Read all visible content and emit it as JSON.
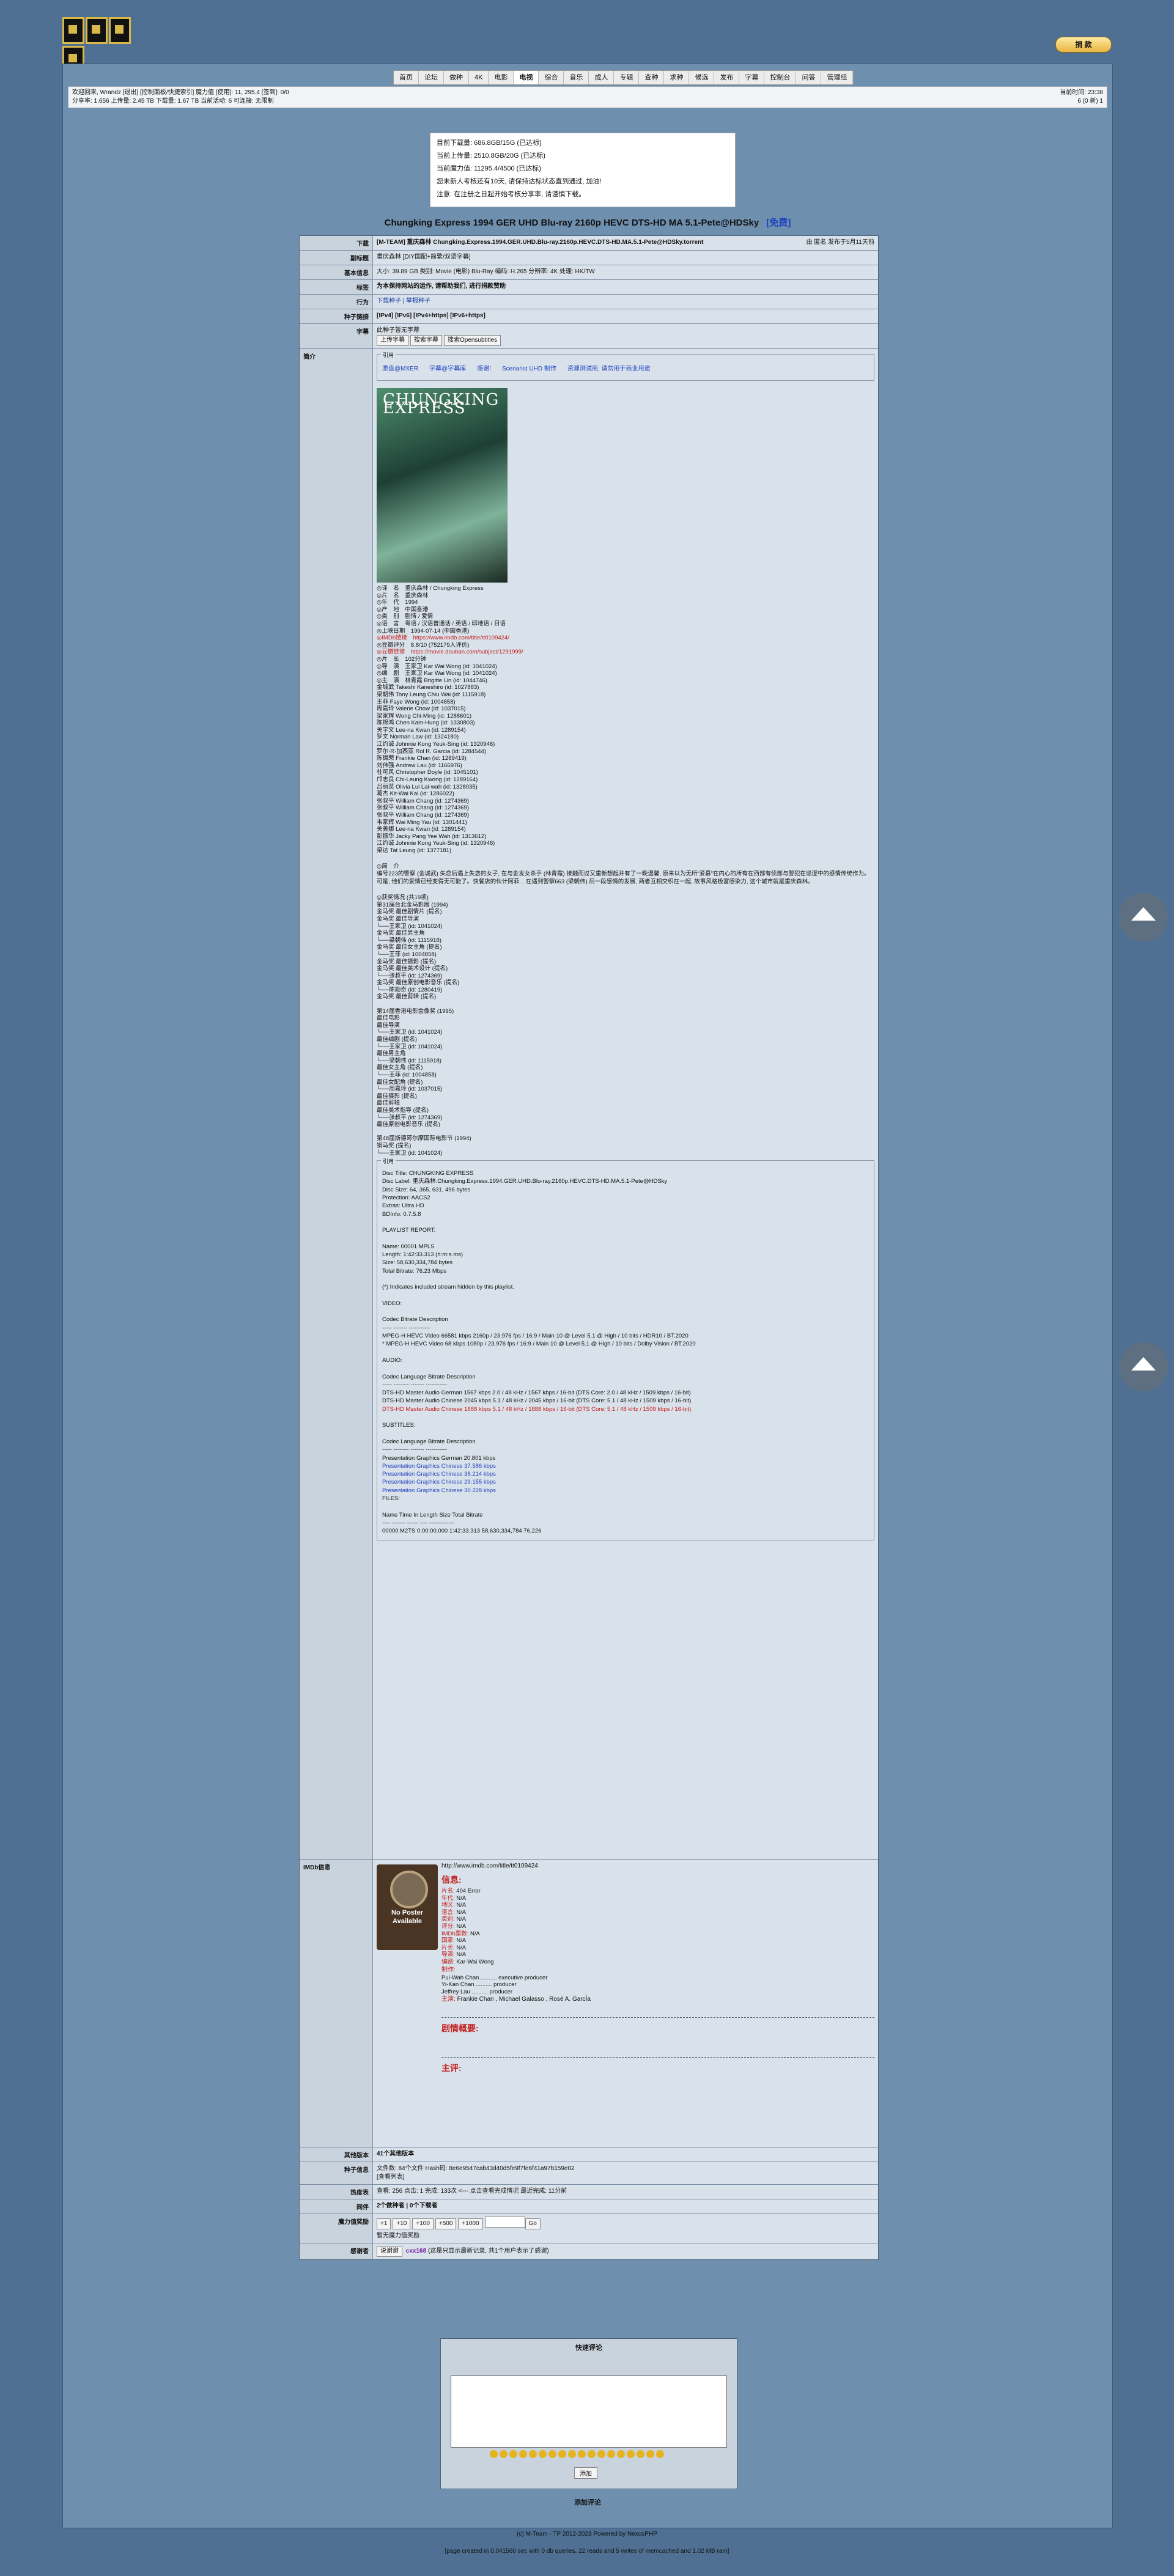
{
  "site": {
    "top_button": "捐 款"
  },
  "nav": [
    "首页",
    "论坛",
    "做种",
    "4K",
    "电影",
    "电视",
    "综合",
    "音乐",
    "成人",
    "专辑",
    "查种",
    "求种",
    "候选",
    "发布",
    "字幕",
    "控制台",
    "问答",
    "管理组"
  ],
  "nav_active": "电视",
  "userbar": {
    "left1": "欢迎回来, Wrandz [退出] [控制面板/快捷索引] 魔力值 [使用]: 11, 295.4 [签到]: 0/0",
    "left2": "分享率: 1.656 上传量: 2.45 TB 下载量: 1.67 TB 当前活动: 6 可连接: 无限制",
    "right1": "当前时间: 23:38",
    "right2": "6 (0 新) 1"
  },
  "notice": [
    "目前下载量: 686.8GB/15G (已达标)",
    "当前上传量: 2510.8GB/20G (已达标)",
    "当前魔力值: 11295.4/4500 (已达标)",
    "您未新人考核还有10天, 请保持达标状态直到通过, 加油!",
    "注意: 在注册之日起开始考核分享率, 请谨慎下载。"
  ],
  "title": "Chungking Express 1994 GER UHD Blu-ray 2160p HEVC DTS-HD MA 5.1-Pete@HDSky",
  "title_tag": "[免费]",
  "rows": {
    "download": {
      "label": "下载",
      "value": "[M-TEAM] 重庆森林 Chungking.Express.1994.GER.UHD.Blu-ray.2160p.HEVC.DTS-HD.MA.5.1-Pete@HDSky.torrent",
      "extra": "由 匿名 发布于5月11天前"
    },
    "subtitle": {
      "label": "副标题",
      "value": "重庆森林 [DIY国配+简繁/双语字幕]"
    },
    "basic": {
      "label": "基本信息",
      "value": "大小: 39.89 GB  类别: Movie (电影)  Blu-Ray 编码: H.265  分辨率: 4K  处理: HK/TW"
    },
    "tag": {
      "label": "标签",
      "value": "为本保持网站的运作, 请帮助我们, 进行捐款赞助"
    },
    "action": {
      "label": "行为",
      "value": "下载种子 | 举报种子"
    },
    "link": {
      "label": "种子链接",
      "value": "[IPv4] [IPv6] [IPv4+https] [IPv6+https]"
    },
    "subs": {
      "label": "字幕",
      "value": "此种子暂无字幕",
      "btns": [
        "上传字幕",
        "搜索字幕",
        "搜索Opensubtitles"
      ]
    },
    "intro": {
      "label": "简介"
    }
  },
  "quote_top": {
    "title": "引用",
    "items": [
      "原盘@MXER",
      "字幕@字幕库",
      "感谢!",
      "Scenarist UHD 制作",
      "资源测试用, 请勿用于商业用途"
    ]
  },
  "poster_text": "CHUNGKING EXPRESS",
  "info_lines": [
    "◎译　名　重庆森林 / Chungking Express",
    "◎片　名　重庆森林",
    "◎年　代　1994",
    "◎产　地　中国香港",
    "◎类　别　剧情 / 爱情",
    "◎语　言　粤语 / 汉语普通话 / 英语 / 印地语 / 日语",
    "◎上映日期　1994-07-14 (中国香港)",
    "◎IMDb链接　https://www.imdb.com/title/tt0109424/",
    "◎豆瓣评分　8.8/10 (752179人评价)",
    "◎豆瓣链接　https://movie.douban.com/subject/1291999/",
    "◎片　长　102分钟",
    "◎导　演　王家卫 Kar Wai Wong (id: 1041024)",
    "◎编　剧　王家卫 Kar Wai Wong (id: 1041024)",
    "◎主　演　林青霞 Brigitte Lin (id: 1044746)",
    "金城武 Takeshi Kaneshiro (id: 1027883)",
    "梁朝伟 Tony Leung Chiu Wai (id: 1115918)",
    "王菲 Faye Wong (id: 1004858)",
    "周嘉玲 Valerie Chow (id: 1037015)",
    "梁家辉 Wong Chi-Ming (id: 1288601)",
    "陈锦鸿 Chen Kam-Hung (id: 1330803)",
    "关学文 Lee-na Kwan (id: 1289154)",
    "罗文 Norman Law (id: 1324180)",
    "江约诚 Johnnie Kong Yeuk-Sing (id: 1320946)",
    "罗尔·R·加西亚 Rol R. Garcia (id: 1284544)",
    "陈锦荣 Frankie Chan (id: 1289419)",
    "刘伟强 Andrew Lau (id: 1166976)",
    "杜可风 Christopher Doyle (id: 1045101)",
    "邝志良 Chi-Leung Kwong (id: 1289164)",
    "吕丽英 Olivia Lui Lai-wah (id: 1328035)",
    "葛杰 Kit-Wai Kai (id: 1286022)",
    "张叔平 William Chang (id: 1274369)",
    "张叔平 William Chang (id: 1274369)",
    "张叔平 William Chang (id: 1274369)",
    "韦家辉 Wai Ming Yau (id: 1301441)",
    "关美娜 Lee-na Kwan (id: 1289154)",
    "彭振华 Jacky Pang Yee Wah (id: 1313612)",
    "江约诚 Johnnie Kong Yeuk-Sing (id: 1320946)",
    "梁达 Tat Leung (id: 1377181)"
  ],
  "synopsis_title": "◎简　介",
  "synopsis": "编号223的警察 (金城武) 失恋后遇上失恋的女子, 在与金发女杀手 (林青霞) 接触而过又重新想起并有了一晚温馨, 原来以为无所“爱慕”在内心的所有在西部有侦部与警犯在巡逻中的感情传统作为。可是, 他们的爱情已经变得无可能了。快餐店的伙计阿菲... 在遇到警察663 (梁朝伟) 后一段感情的发展, 两者互相交织在一起, 故事风格极富感染力, 这个城市就是重庆森林。",
  "awards_title": "◎获奖情况 (共19项)",
  "awards": [
    "第31届台北金马影展 (1994)",
    "金马奖 最佳剧情片 (提名)",
    "金马奖 最佳导演",
    "└──王家卫 (id: 1041024)",
    "金马奖 最佳男主角",
    "└──梁朝伟 (id: 1115918)",
    "金马奖 最佳女主角 (提名)",
    "└──王菲 (id: 1004858)",
    "金马奖 最佳摄影 (提名)",
    "金马奖 最佳美术设计 (提名)",
    "└──张叔平 (id: 1274369)",
    "金马奖 最佳原创电影音乐 (提名)",
    "└──陈勋奇 (id: 1280419)",
    "金马奖 最佳剪辑 (提名)",
    "",
    "第14届香港电影金像奖 (1995)",
    "最佳电影",
    "最佳导演",
    "└──王家卫 (id: 1041024)",
    "最佳编剧 (提名)",
    "└──王家卫 (id: 1041024)",
    "最佳男主角",
    "└──梁朝伟 (id: 1115918)",
    "最佳女主角 (提名)",
    "└──王菲 (id: 1004858)",
    "最佳女配角 (提名)",
    "└──周嘉玲 (id: 1037015)",
    "最佳摄影 (提名)",
    "最佳剪辑",
    "最佳美术指导 (提名)",
    "└──张叔平 (id: 1274369)",
    "最佳原创电影音乐 (提名)",
    "",
    "第48届斯德哥尔摩国际电影节 (1994)",
    "铜马奖 (提名)",
    "└──王家卫 (id: 1041024)"
  ],
  "mediainfo": [
    {
      "t": "Disc Title:   CHUNGKING EXPRESS",
      "c": ""
    },
    {
      "t": "Disc Label:   重庆森林.Chungking.Express.1994.GER.UHD.Blu-ray.2160p.HEVC.DTS-HD.MA.5.1-Pete@HDSky",
      "c": ""
    },
    {
      "t": "Disc Size:   64, 365, 631, 496 bytes",
      "c": ""
    },
    {
      "t": "Protection:  AACS2",
      "c": ""
    },
    {
      "t": "Extras:  Ultra HD",
      "c": ""
    },
    {
      "t": "BDInfo:  0.7.5.8",
      "c": ""
    },
    {
      "t": "",
      "c": ""
    },
    {
      "t": "PLAYLIST REPORT:",
      "c": ""
    },
    {
      "t": "",
      "c": ""
    },
    {
      "t": "Name:  00001.MPLS",
      "c": ""
    },
    {
      "t": "Length:  1:42:33.313 (h:m:s.ms)",
      "c": ""
    },
    {
      "t": "Size:  58,630,334,784 bytes",
      "c": ""
    },
    {
      "t": "Total Bitrate:  76.23 Mbps",
      "c": ""
    },
    {
      "t": "",
      "c": ""
    },
    {
      "t": "(*) Indicates included stream hidden by this playlist.",
      "c": ""
    },
    {
      "t": "",
      "c": ""
    },
    {
      "t": "VIDEO:",
      "c": ""
    },
    {
      "t": "",
      "c": ""
    },
    {
      "t": "Codec  Bitrate  Description",
      "c": ""
    },
    {
      "t": "-----  -------  -----------",
      "c": ""
    },
    {
      "t": "MPEG-H HEVC Video  66581 kbps  2160p / 23.976 fps / 16:9 / Main 10 @ Level 5.1 @ High / 10 bits / HDR10 / BT.2020",
      "c": ""
    },
    {
      "t": "* MPEG-H HEVC Video  68 kbps  1080p / 23.976 fps / 16:9 / Main 10 @ Level 5.1 @ High / 10 bits / Dolby Vision / BT.2020",
      "c": ""
    },
    {
      "t": "",
      "c": ""
    },
    {
      "t": "AUDIO:",
      "c": ""
    },
    {
      "t": "",
      "c": ""
    },
    {
      "t": "Codec  Language  Bitrate  Description",
      "c": ""
    },
    {
      "t": "-----  --------  -------  -----------",
      "c": ""
    },
    {
      "t": "DTS-HD Master Audio  German  1567 kbps  2.0 / 48 kHz / 1567 kbps / 16-bit (DTS Core: 2.0 / 48 kHz / 1509 kbps / 16-bit)",
      "c": ""
    },
    {
      "t": "DTS-HD Master Audio  Chinese  2045 kbps  5.1 / 48 kHz / 2045 kbps / 16-bit (DTS Core: 5.1 / 48 kHz / 1509 kbps / 16-bit)",
      "c": ""
    },
    {
      "t": "DTS-HD Master Audio  Chinese  1888 kbps  5.1 / 48 kHz / 1888 kbps / 16-bit (DTS Core: 5.1 / 48 kHz / 1509 kbps / 16-bit)",
      "c": "red"
    },
    {
      "t": "",
      "c": ""
    },
    {
      "t": "SUBTITLES:",
      "c": ""
    },
    {
      "t": "",
      "c": ""
    },
    {
      "t": "Codec  Language  Bitrate  Description",
      "c": ""
    },
    {
      "t": "-----  --------  -------  -----------",
      "c": ""
    },
    {
      "t": "Presentation Graphics  German  20.801 kbps",
      "c": ""
    },
    {
      "t": "Presentation Graphics  Chinese  37.586 kbps",
      "c": "blue"
    },
    {
      "t": "Presentation Graphics  Chinese  38.214 kbps",
      "c": "blue"
    },
    {
      "t": "Presentation Graphics  Chinese  29.155 kbps",
      "c": "blue"
    },
    {
      "t": "Presentation Graphics  Chinese  30.228 kbps",
      "c": "blue"
    },
    {
      "t": "FILES:",
      "c": ""
    },
    {
      "t": "",
      "c": ""
    },
    {
      "t": "Name  Time In  Length  Size  Total Bitrate",
      "c": ""
    },
    {
      "t": "----  -------  ------  ----  -------------",
      "c": ""
    },
    {
      "t": "00000.M2TS  0:00:00.000  1:42:33.313  58,630,334,784  76,226",
      "c": ""
    }
  ],
  "imdb": {
    "label": "IMDb信息",
    "url": "http://www.imdb.com/title/tt0109424",
    "poster": "No Poster Available",
    "head": "信息:",
    "fields": [
      [
        "片名:",
        "404 Error"
      ],
      [
        "年代:",
        "N/A"
      ],
      [
        "地区:",
        "N/A"
      ],
      [
        "语言:",
        "N/A"
      ],
      [
        "类别:",
        "N/A"
      ],
      [
        "评分:",
        "N/A"
      ],
      [
        "IMDb票数:",
        "N/A"
      ],
      [
        "国家:",
        "N/A"
      ],
      [
        "片长:",
        "N/A"
      ],
      [
        "导演:",
        "N/A"
      ],
      [
        "编剧:",
        "Kar-Wai Wong"
      ]
    ],
    "producers_label": "制作:",
    "producers": [
      "Pui-Wah Chan .......... executive producer",
      "Yi-Kan Chan .......... producer",
      "Jeffrey Lau .......... producer"
    ],
    "cast_label": "主演:",
    "cast": "Frankie Chan ,  Michael Galasso ,  Rosé A. GarcÍa",
    "plot": "剧情概要:",
    "reviews": "主评:"
  },
  "other_versions": {
    "label": "其他版本",
    "value": "41个其他版本"
  },
  "torrent_info": {
    "label": "种子信息",
    "value": "文件数: 84个文件  Hash码: 8e6e9547cab43d40d5fe9f7fe6f41a97b159e02",
    "sub": "[查看列表]"
  },
  "hot": {
    "label": "热度表",
    "value": "查看: 256  点击: 1  完成: 133次 <--- 点击查看完成情况  最近完成: 11分前"
  },
  "peers": {
    "label": "同伴",
    "value": "2个做种者 | 0个下载者"
  },
  "bonus": {
    "label": "魔力值奖励",
    "btns": [
      "+1",
      "+10",
      "+100",
      "+500",
      "+1000"
    ],
    "go": "Go",
    "note": "暂无魔力值奖励"
  },
  "thanks": {
    "label": "感谢者",
    "btn": "说谢谢",
    "user": "cxx168",
    "note": "(这是只显示最新记录, 共1个用户表示了感谢)"
  },
  "comment": {
    "title": "快速评论",
    "add": "添加",
    "add_comment": "添加评论"
  },
  "footer": {
    "line1": "(c) M-Team - TP 2012-2023 Powered by NexusPHP",
    "line2": "[page created in 0.041560 sec with 0 db queries, 22 reads and 5 writes of memcached and 1.02 MB ram]"
  }
}
